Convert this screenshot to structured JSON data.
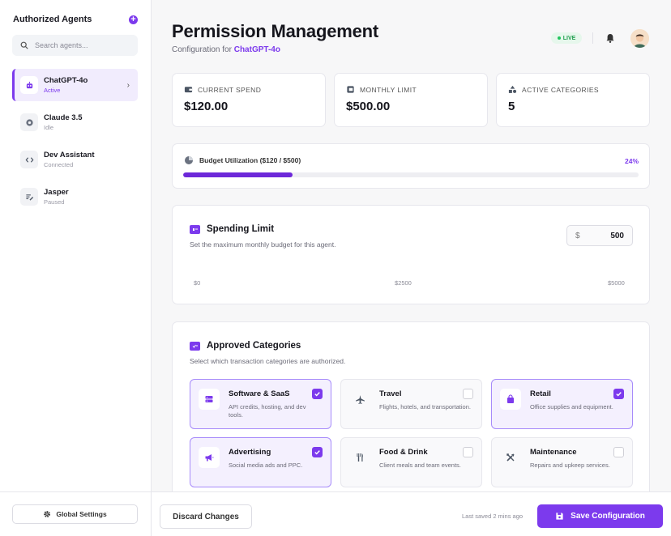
{
  "sidebar": {
    "title": "Authorized Agents",
    "add_icon": "plus-circle-icon",
    "search_placeholder": "Search agents...",
    "agents": [
      {
        "name": "ChatGPT-4o",
        "status": "Active",
        "icon": "robot-icon"
      },
      {
        "name": "Claude 3.5",
        "status": "Idle",
        "icon": "brain-icon"
      },
      {
        "name": "Dev Assistant",
        "status": "Connected",
        "icon": "code-icon"
      },
      {
        "name": "Jasper",
        "status": "Paused",
        "icon": "pen-icon"
      }
    ],
    "global_settings_label": "Global Settings"
  },
  "header": {
    "title": "Permission Management",
    "subtitle_prefix": "Configuration for",
    "subtitle_agent": "ChatGPT-4o",
    "live_badge": "LIVE"
  },
  "stats": [
    {
      "label": "CURRENT SPEND",
      "value": "$120.00",
      "icon": "wallet-icon"
    },
    {
      "label": "MONTHLY LIMIT",
      "value": "$500.00",
      "icon": "calendar-card-icon"
    },
    {
      "label": "ACTIVE CATEGORIES",
      "value": "5",
      "icon": "shapes-icon"
    }
  ],
  "budget": {
    "label": "Budget Utilization ($120 / $500)",
    "percent_text": "24%",
    "fraction": 0.24
  },
  "spending_limit": {
    "title": "Spending Limit",
    "subtitle": "Set the maximum monthly budget for this agent.",
    "currency": "$",
    "value": "500",
    "ticks": [
      "$0",
      "$2500",
      "$5000"
    ]
  },
  "categories": {
    "title": "Approved Categories",
    "subtitle": "Select which transaction categories are authorized.",
    "items": [
      {
        "name": "Software & SaaS",
        "desc": "API credits, hosting, and dev tools.",
        "checked": true,
        "icon": "server-icon"
      },
      {
        "name": "Travel",
        "desc": "Flights, hotels, and transportation.",
        "checked": false,
        "icon": "plane-icon"
      },
      {
        "name": "Retail",
        "desc": "Office supplies and equipment.",
        "checked": true,
        "icon": "shopping-bag-icon"
      },
      {
        "name": "Advertising",
        "desc": "Social media ads and PPC.",
        "checked": true,
        "icon": "megaphone-icon"
      },
      {
        "name": "Food & Drink",
        "desc": "Client meals and team events.",
        "checked": false,
        "icon": "utensils-icon"
      },
      {
        "name": "Maintenance",
        "desc": "Repairs and upkeep services.",
        "checked": false,
        "icon": "tools-icon"
      }
    ]
  },
  "footer": {
    "discard_label": "Discard Changes",
    "last_saved": "Last saved 2 mins ago",
    "save_label": "Save Configuration"
  },
  "colors": {
    "accent": "#7c3aed",
    "live_green": "#22c55e"
  }
}
